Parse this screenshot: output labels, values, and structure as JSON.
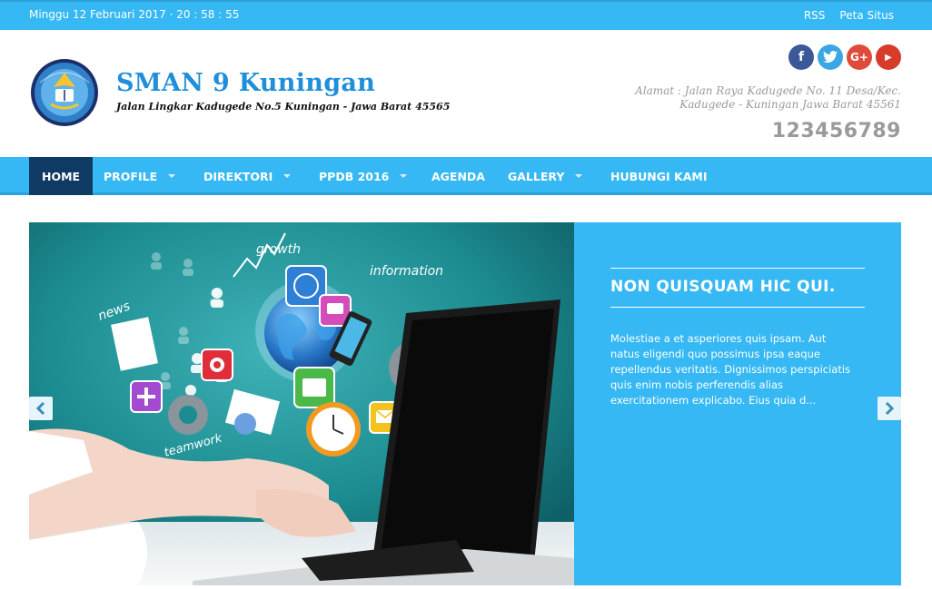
{
  "topbar": {
    "datetime": "Minggu 12 Februari 2017 · 20 : 58 : 55",
    "links": [
      "RSS",
      "Peta Situs"
    ]
  },
  "header": {
    "title": "SMAN 9 Kuningan",
    "subtitle": "Jalan Lingkar Kadugede No.5 Kuningan - Jawa Barat 45565",
    "address_line1": "Alamat : Jalan Raya Kadugede No. 11 Desa/Kec.",
    "address_line2": "Kadugede - Kuningan Jawa Barat 45561",
    "phone": "123456789",
    "social": {
      "facebook": "f",
      "twitter": "t",
      "googleplus": "G+",
      "youtube": "▶"
    }
  },
  "nav": {
    "items": [
      {
        "label": "HOME"
      },
      {
        "label": "PROFILE"
      },
      {
        "label": "DIREKTORI"
      },
      {
        "label": "PPDB 2016"
      },
      {
        "label": "AGENDA"
      },
      {
        "label": "GALLERY"
      },
      {
        "label": "HUBUNGI KAMI"
      }
    ]
  },
  "slider": {
    "title": "NON QUISQUAM HIC QUI.",
    "text": "Molestiae a et asperiores quis ipsam. Aut natus eligendi quo possimus ipsa eaque repellendus veritatis. Dignissimos perspiciatis quis enim nobis perferendis alias exercitationem explicabo. Eius quia d...",
    "image_labels": {
      "growth": "growth",
      "information": "information",
      "news": "news",
      "teamwork": "teamwork"
    }
  },
  "colors": {
    "primary": "#35b8f3",
    "nav_active": "#0f3a63",
    "title_blue": "#1f8fd9"
  }
}
